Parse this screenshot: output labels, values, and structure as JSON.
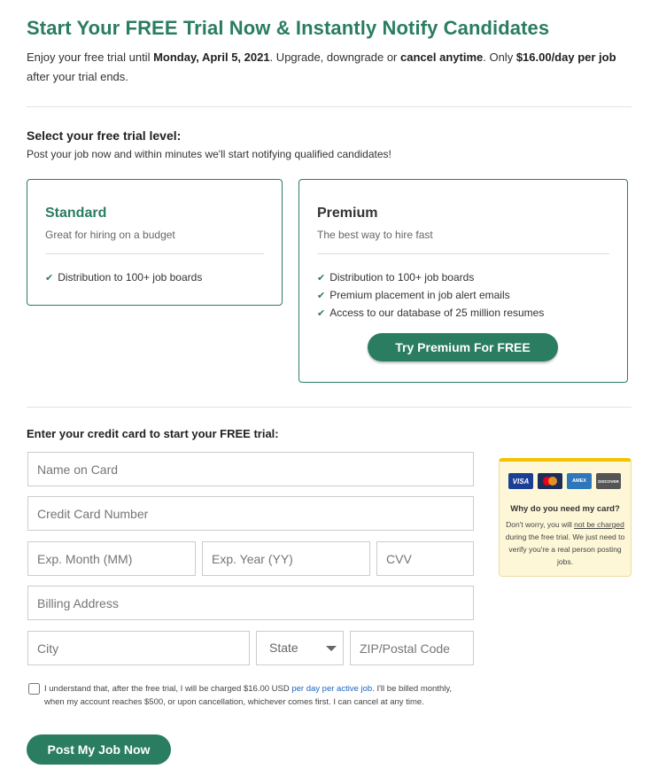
{
  "header": {
    "title": "Start Your FREE Trial Now & Instantly Notify Candidates",
    "intro_1": "Enjoy your free trial until ",
    "trial_end": "Monday, April 5, 2021",
    "intro_2": ". Upgrade, downgrade or ",
    "cancel": "cancel anytime",
    "intro_3": ". Only ",
    "price": "$16.00/day per job",
    "intro_4": " after your trial ends."
  },
  "trial": {
    "heading": "Select your free trial level:",
    "subheading": "Post your job now and within minutes we'll start notifying qualified candidates!",
    "check_glyph": "✔",
    "standard": {
      "name": "Standard",
      "tagline": "Great for hiring on a budget",
      "features": [
        "Distribution to 100+ job boards"
      ]
    },
    "premium": {
      "name": "Premium",
      "tagline": "The best way to hire fast",
      "features": [
        "Distribution to 100+ job boards",
        "Premium placement in job alert emails",
        "Access to our database of 25 million resumes"
      ],
      "button": "Try Premium For FREE"
    }
  },
  "payment": {
    "heading": "Enter your credit card to start your FREE trial:",
    "name_placeholder": "Name on Card",
    "card_placeholder": "Credit Card Number",
    "month_placeholder": "Exp. Month (MM)",
    "year_placeholder": "Exp. Year (YY)",
    "cvv_placeholder": "CVV",
    "address_placeholder": "Billing Address",
    "city_placeholder": "City",
    "state_value": "State",
    "zip_placeholder": "ZIP/Postal Code"
  },
  "why_card": {
    "logos": [
      "VISA",
      "MasterCard",
      "AMEX",
      "DISCOVER"
    ],
    "heading": "Why do you need my card?",
    "p1": "Don't worry, you will ",
    "p1_u": "not be charged",
    "p2": " during the free trial. We just need to verify you're a real person posting jobs."
  },
  "agreement": {
    "text_1": "I understand that, after the free trial, I will be charged $16.00 USD ",
    "link": "per day per active job",
    "text_2": ". I'll be billed monthly, when my account reaches $500, or upon cancellation, whichever comes first. I can cancel at any time."
  },
  "submit_label": "Post My Job Now",
  "colors": {
    "brand": "#2a7d61",
    "note_bg": "#fdf7d8",
    "note_border": "#f2c400",
    "link": "#2166c0"
  }
}
